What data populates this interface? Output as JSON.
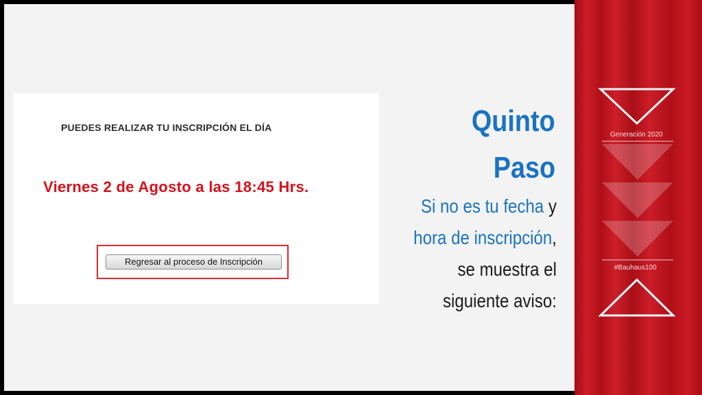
{
  "screenshot": {
    "heading": "PUEDES REALIZAR TU INSCRIPCIÓN EL DÍA",
    "date_text": "Viernes 2 de Agosto a las 18:45 Hrs.",
    "button_label": "Regresar al proceso de Inscripción"
  },
  "title": {
    "line1": "Quinto",
    "line2": "Paso"
  },
  "body": {
    "part1": "Si no es tu fecha",
    "part2": " y",
    "part3": "hora de inscripción",
    "part4": ",",
    "part5": "se muestra el",
    "part6": "siguiente aviso:"
  },
  "sidebar": {
    "tag_top": "Generación 2020",
    "tag_bottom": "#Bauhaus100"
  },
  "colors": {
    "accent_blue": "#1a73c2",
    "alert_red": "#d7101a",
    "curtain_red": "#c8111c"
  }
}
